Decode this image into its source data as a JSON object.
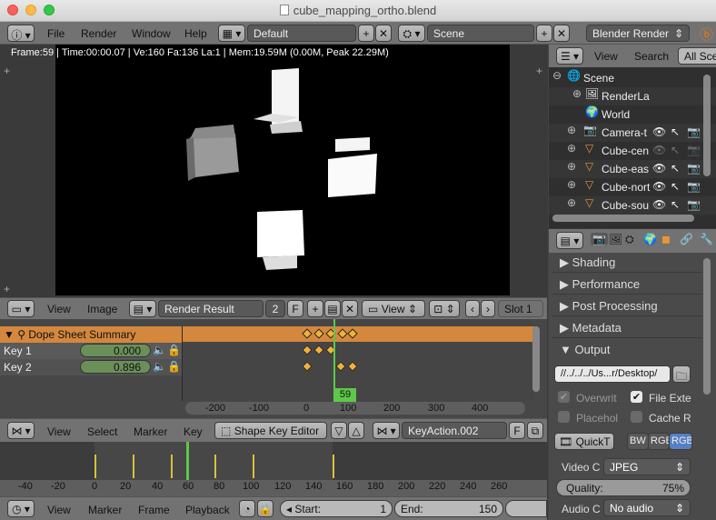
{
  "window": {
    "title": "cube_mapping_ortho.blend"
  },
  "infobar": {
    "menus": [
      "File",
      "Render",
      "Window",
      "Help"
    ],
    "screen_layout": "Default",
    "scene": "Scene",
    "engine": "Blender Render"
  },
  "viewport": {
    "stats": "Frame:59 | Time:00:00.07 | Ve:160 Fa:136 La:1 | Mem:19.59M (0.00M, Peak 22.29M)"
  },
  "image_header": {
    "menus": [
      "View",
      "Image"
    ],
    "image_name": "Render Result",
    "users": "2",
    "fake_user": "F",
    "view_menu": "View",
    "slot": "Slot 1"
  },
  "dope": {
    "summary": "Dope Sheet Summary",
    "rows": [
      {
        "label": "Key 1",
        "value": "0.000"
      },
      {
        "label": "Key 2",
        "value": "0.896"
      }
    ],
    "current_frame": "59",
    "ruler": [
      "-200",
      "-100",
      "0",
      "100",
      "200",
      "300",
      "400"
    ]
  },
  "dope_header": {
    "menus": [
      "View",
      "Select",
      "Marker",
      "Key"
    ],
    "mode": "Shape Key Editor",
    "action": "KeyAction.002",
    "fake_user": "F"
  },
  "timeline": {
    "ruler": [
      "-40",
      "-20",
      "0",
      "20",
      "40",
      "60",
      "80",
      "100",
      "120",
      "140",
      "160",
      "180",
      "200",
      "220",
      "240",
      "260"
    ]
  },
  "timeline_header": {
    "menus": [
      "View",
      "Marker",
      "Frame",
      "Playback"
    ],
    "start_label": "Start:",
    "start": "1",
    "end_label": "End:",
    "end": "150"
  },
  "outliner": {
    "menus": [
      "View",
      "Search"
    ],
    "filter": "All Sce",
    "items": [
      "Scene",
      "RenderLa",
      "World",
      "Camera-t",
      "Cube-cen",
      "Cube-eas",
      "Cube-nort",
      "Cube-sou"
    ]
  },
  "properties": {
    "panels": [
      "Shading",
      "Performance",
      "Post Processing",
      "Metadata",
      "Output"
    ],
    "output_path": "//../../../Us...r/Desktop/",
    "overwrite": "Overwrit",
    "file_ext": "File Exte",
    "placeholders": "Placehol",
    "cache_result": "Cache R",
    "format": "QuickT",
    "color_modes": [
      "BW",
      "RGB",
      "RGB"
    ],
    "video_codec_label": "Video C",
    "video_codec": "JPEG",
    "quality_label": "Quality:",
    "quality": "75%",
    "audio_codec_label": "Audio C",
    "audio_codec": "No audio"
  }
}
